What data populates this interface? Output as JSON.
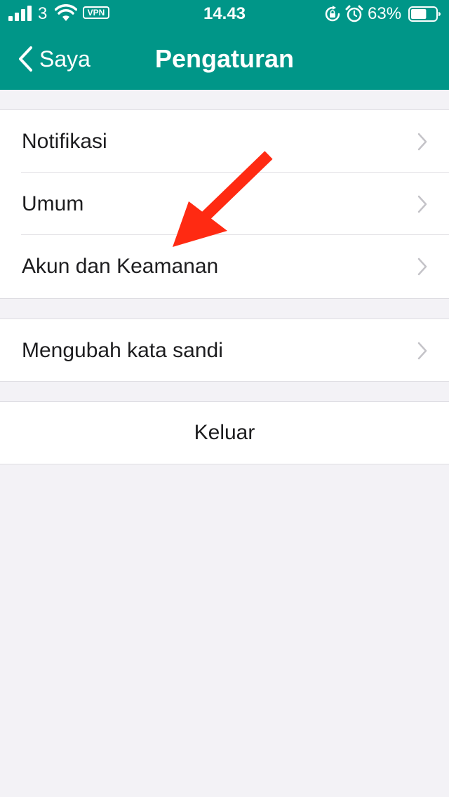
{
  "status_bar": {
    "carrier": "3",
    "vpn": "VPN",
    "time": "14.43",
    "battery_percent": "63%",
    "battery_level": 0.63,
    "icons": [
      "signal-icon",
      "wifi-icon",
      "vpn-icon",
      "rotation-lock-icon",
      "alarm-icon",
      "battery-icon"
    ]
  },
  "nav": {
    "back_label": "Saya",
    "title": "Pengaturan"
  },
  "settings": {
    "group1": [
      {
        "label": "Notifikasi"
      },
      {
        "label": "Umum"
      },
      {
        "label": "Akun dan Keamanan"
      }
    ],
    "group2": [
      {
        "label": "Mengubah kata sandi"
      }
    ],
    "logout_label": "Keluar"
  },
  "colors": {
    "header": "#009688",
    "background": "#f3f2f6",
    "annotation_arrow": "#ff2a12",
    "chevron": "#c4c3c8"
  }
}
